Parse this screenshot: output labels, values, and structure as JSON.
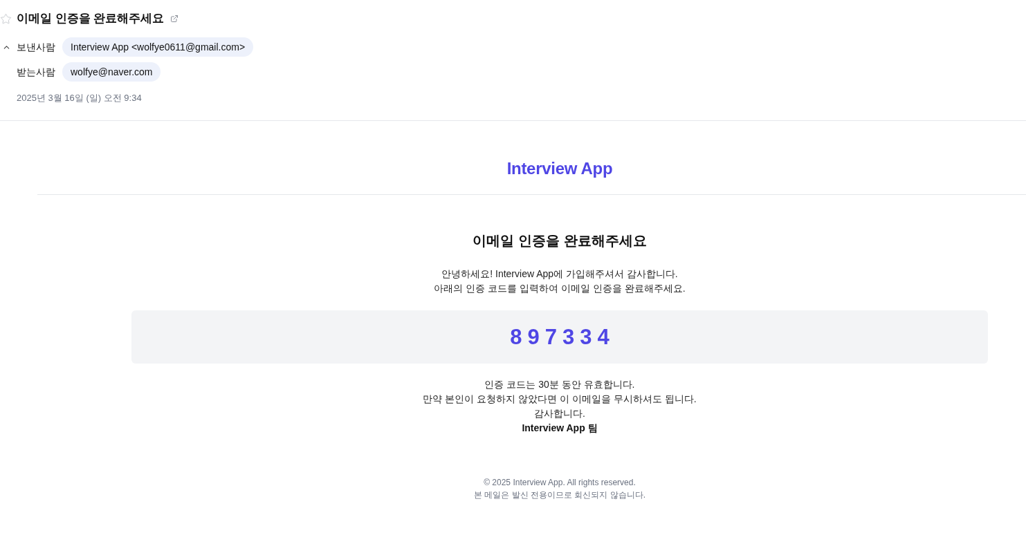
{
  "message": {
    "subject": "이메일 인증을 완료해주세요",
    "starred": false,
    "details_expanded": true,
    "sender": {
      "label": "보낸사람",
      "value": "Interview App <wolfye0611@gmail.com>"
    },
    "recipient": {
      "label": "받는사람",
      "value": "wolfye@naver.com"
    },
    "date": "2025년 3월 16일 (일) 오전 9:34"
  },
  "body": {
    "logo": "Interview App",
    "heading": "이메일 인증을 완료해주세요",
    "intro": [
      "안녕하세요! Interview App에 가입해주셔서 감사합니다.",
      "아래의 인증 코드를 입력하여 이메일 인증을 완료해주세요."
    ],
    "code": "897334",
    "closing": [
      "인증 코드는 30분 동안 유효합니다.",
      "만약 본인이 요청하지 않았다면 이 이메일을 무시하셔도 됩니다.",
      "감사합니다."
    ],
    "signature": "Interview App 팀",
    "footer": [
      "© 2025 Interview App. All rights reserved.",
      "본 메일은 발신 전용이므로 회신되지 않습니다."
    ]
  }
}
